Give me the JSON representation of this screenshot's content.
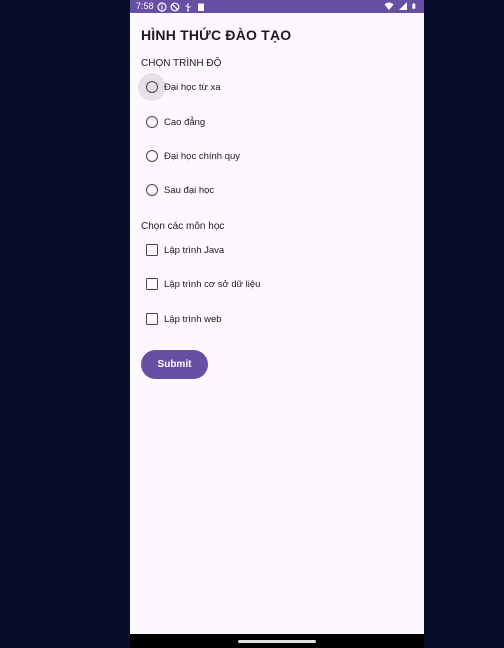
{
  "status_bar": {
    "time": "7:58",
    "left_icons": [
      "info-icon",
      "blocked-icon",
      "usb-icon",
      "clipboard-icon"
    ],
    "right_icons": [
      "wifi-icon",
      "signal-icon",
      "battery-icon"
    ],
    "color": "#6750a4"
  },
  "page": {
    "title": "HÌNH THỨC ĐÀO TẠO",
    "level_section_label": "CHỌN TRÌNH ĐỘ",
    "level_options": [
      {
        "label": "Đại học từ xa",
        "selected": false
      },
      {
        "label": "Cao đẳng",
        "selected": false
      },
      {
        "label": "Đại học chính quy",
        "selected": false
      },
      {
        "label": "Sau đại học",
        "selected": false
      }
    ],
    "course_section_label": "Chọn các môn học",
    "course_options": [
      {
        "label": "Lập trình Java",
        "checked": false
      },
      {
        "label": "Lập trình cơ sở dữ liệu",
        "checked": false
      },
      {
        "label": "Lập trình web",
        "checked": false
      }
    ],
    "submit_label": "Submit"
  },
  "colors": {
    "accent": "#6750a4",
    "background": "#fdf7fe",
    "outer_background": "#070e2c"
  }
}
